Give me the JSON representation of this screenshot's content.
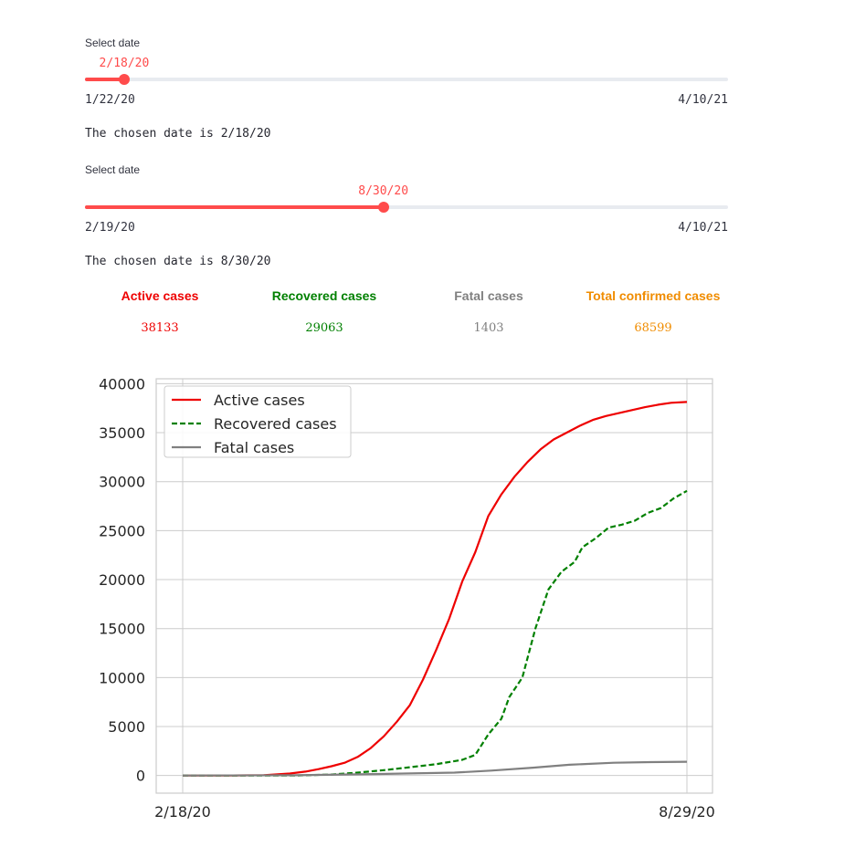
{
  "sliders": [
    {
      "label": "Select date",
      "value": "2/18/20",
      "min": "1/22/20",
      "max": "4/10/21",
      "fraction": 0.061,
      "chosen_text": "The chosen date is 2/18/20"
    },
    {
      "label": "Select date",
      "value": "8/30/20",
      "min": "2/19/20",
      "max": "4/10/21",
      "fraction": 0.464,
      "chosen_text": "The chosen date is 8/30/20"
    }
  ],
  "stats": [
    {
      "label": "Active cases",
      "value": "38133",
      "color": "#ee0000"
    },
    {
      "label": "Recovered cases",
      "value": "29063",
      "color": "#008000"
    },
    {
      "label": "Fatal cases",
      "value": "1403",
      "color": "#808080"
    },
    {
      "label": "Total confirmed cases",
      "value": "68599",
      "color": "#f08c00"
    }
  ],
  "chart_data": {
    "type": "line",
    "x_start": "2/18/20",
    "x_end": "8/29/20",
    "x_tick_labels": [
      "2/18/20",
      "8/29/20"
    ],
    "ylim": [
      -1800,
      40500
    ],
    "yticks": [
      0,
      5000,
      10000,
      15000,
      20000,
      25000,
      30000,
      35000,
      40000
    ],
    "grid": true,
    "legend_position": "top-left",
    "series": [
      {
        "name": "Active cases",
        "color": "#ee0000",
        "style": "solid",
        "points": [
          [
            "2/18/20",
            0
          ],
          [
            "3/5/20",
            0
          ],
          [
            "3/20/20",
            40
          ],
          [
            "3/30/20",
            200
          ],
          [
            "4/5/20",
            400
          ],
          [
            "4/10/20",
            650
          ],
          [
            "4/15/20",
            950
          ],
          [
            "4/20/20",
            1300
          ],
          [
            "4/25/20",
            1900
          ],
          [
            "4/30/20",
            2800
          ],
          [
            "5/5/20",
            4000
          ],
          [
            "5/10/20",
            5500
          ],
          [
            "5/15/20",
            7200
          ],
          [
            "5/20/20",
            9800
          ],
          [
            "5/25/20",
            12800
          ],
          [
            "5/30/20",
            16000
          ],
          [
            "6/4/20",
            19800
          ],
          [
            "6/9/20",
            22800
          ],
          [
            "6/14/20",
            26500
          ],
          [
            "6/19/20",
            28700
          ],
          [
            "6/24/20",
            30500
          ],
          [
            "6/29/20",
            32000
          ],
          [
            "7/4/20",
            33300
          ],
          [
            "7/9/20",
            34300
          ],
          [
            "7/14/20",
            35000
          ],
          [
            "7/19/20",
            35700
          ],
          [
            "7/24/20",
            36300
          ],
          [
            "7/29/20",
            36700
          ],
          [
            "8/3/20",
            37000
          ],
          [
            "8/8/20",
            37300
          ],
          [
            "8/13/20",
            37600
          ],
          [
            "8/18/20",
            37850
          ],
          [
            "8/23/20",
            38050
          ],
          [
            "8/29/20",
            38133
          ]
        ]
      },
      {
        "name": "Recovered cases",
        "color": "#008000",
        "style": "dashed",
        "points": [
          [
            "2/18/20",
            0
          ],
          [
            "4/1/20",
            0
          ],
          [
            "4/15/20",
            100
          ],
          [
            "4/25/20",
            300
          ],
          [
            "5/5/20",
            550
          ],
          [
            "5/15/20",
            850
          ],
          [
            "5/25/20",
            1150
          ],
          [
            "6/4/20",
            1600
          ],
          [
            "6/9/20",
            2100
          ],
          [
            "6/14/20",
            4200
          ],
          [
            "6/19/20",
            5800
          ],
          [
            "6/22/20",
            8000
          ],
          [
            "6/27/20",
            10000
          ],
          [
            "7/2/20",
            15000
          ],
          [
            "7/7/20",
            19000
          ],
          [
            "7/12/20",
            20800
          ],
          [
            "7/17/20",
            21800
          ],
          [
            "7/20/20",
            23300
          ],
          [
            "7/25/20",
            24200
          ],
          [
            "7/30/20",
            25300
          ],
          [
            "8/4/20",
            25600
          ],
          [
            "8/9/20",
            26000
          ],
          [
            "8/14/20",
            26800
          ],
          [
            "8/19/20",
            27300
          ],
          [
            "8/24/20",
            28300
          ],
          [
            "8/29/20",
            29063
          ]
        ]
      },
      {
        "name": "Fatal cases",
        "color": "#808080",
        "style": "solid",
        "points": [
          [
            "2/18/20",
            0
          ],
          [
            "4/1/20",
            30
          ],
          [
            "5/1/20",
            150
          ],
          [
            "6/1/20",
            300
          ],
          [
            "6/15/20",
            500
          ],
          [
            "7/1/20",
            800
          ],
          [
            "7/15/20",
            1100
          ],
          [
            "8/1/20",
            1300
          ],
          [
            "8/15/20",
            1370
          ],
          [
            "8/29/20",
            1403
          ]
        ]
      }
    ]
  }
}
